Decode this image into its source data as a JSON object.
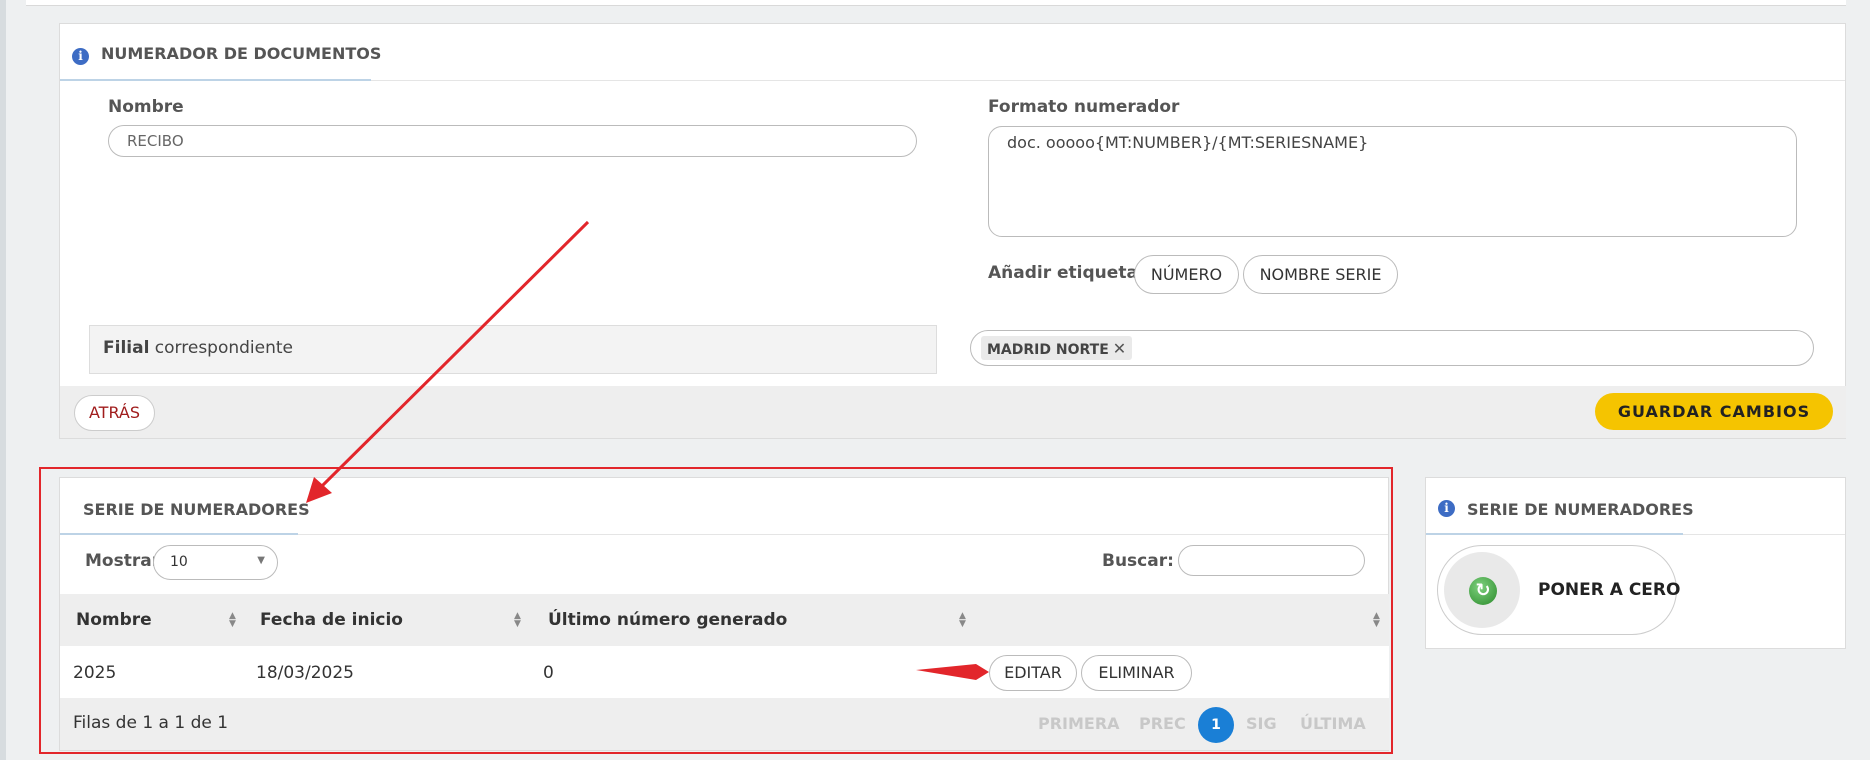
{
  "header": {
    "title": "NUMERADOR DE DOCUMENTOS"
  },
  "form": {
    "nombre_label": "Nombre",
    "nombre_value": "RECIBO",
    "formato_label": "Formato numerador",
    "formato_value": "doc. ooooo{MT:NUMBER}/{MT:SERIESNAME}",
    "etiquetas_label": "Añadir etiquetas:",
    "etiqueta_numero": "NÚMERO",
    "etiqueta_nombre_serie": "NOMBRE SERIE",
    "filial_bold": "Filial",
    "filial_rest": " correspondiente",
    "filial_tag": "MADRID NORTE",
    "remove_symbol": "✕"
  },
  "footer": {
    "back": "ATRÁS",
    "save": "GUARDAR CAMBIOS"
  },
  "series_panel": {
    "title": "SERIE DE NUMERADORES",
    "show_label": "Mostrar",
    "show_value": "10",
    "search_label": "Buscar:",
    "columns": [
      "Nombre",
      "Fecha de inicio",
      "Último número generado"
    ],
    "rows": [
      {
        "nombre": "2025",
        "fecha": "18/03/2025",
        "ultimo": "0",
        "edit": "EDITAR",
        "delete": "ELIMINAR"
      }
    ],
    "rows_info": "Filas de 1 a 1 de 1",
    "pagination": {
      "first": "PRIMERA",
      "prev": "PREC",
      "current": "1",
      "next": "SIG",
      "last": "ÚLTIMA"
    }
  },
  "side_panel": {
    "title": "SERIE DE NUMERADORES",
    "reset": "PONER A CERO"
  },
  "colors": {
    "accent_yellow": "#f5c400",
    "annotation_red": "#e2262b",
    "page_blue": "#1a7fd6",
    "info_blue": "#3d6cc4"
  }
}
